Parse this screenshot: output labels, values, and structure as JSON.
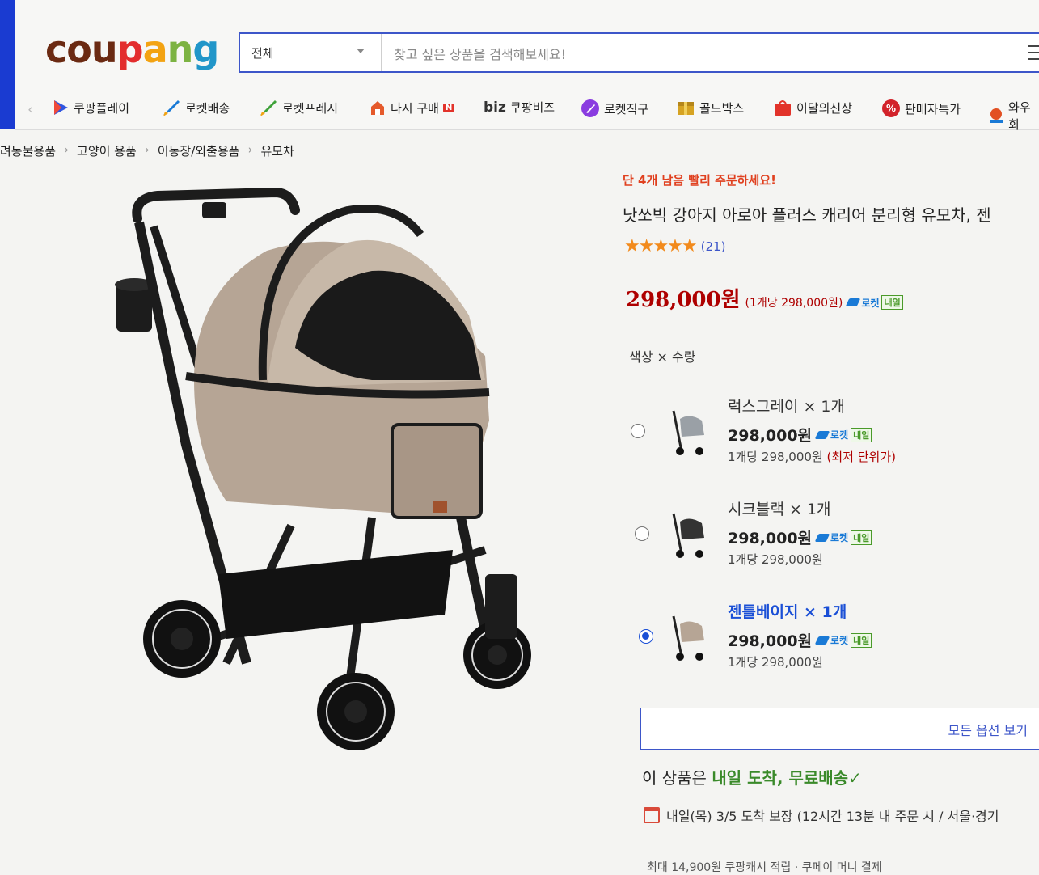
{
  "logo": {
    "parts": [
      "cou",
      "p",
      "a",
      "n",
      "g"
    ]
  },
  "search": {
    "category": "전체",
    "placeholder": "찾고 싶은 상품을 검색해보세요!"
  },
  "nav": {
    "prev_glyph": "‹",
    "items": [
      {
        "label": "쿠팡플레이",
        "icon": "play-icon",
        "color": "#2f55e0"
      },
      {
        "label": "로켓배송",
        "icon": "rocket-icon",
        "color": "#1a7ad6"
      },
      {
        "label": "로켓프레시",
        "icon": "rocket-fresh-icon",
        "color": "#3fa23a"
      },
      {
        "label": "다시 구매",
        "icon": "repurchase-icon",
        "color": "#e55a2b",
        "badge": "N"
      },
      {
        "label": "쿠팡비즈",
        "prefix": "biz",
        "icon": "biz-icon",
        "color": "#222222"
      },
      {
        "label": "로켓직구",
        "icon": "rocket-global-icon",
        "color": "#8a3ce0"
      },
      {
        "label": "골드박스",
        "icon": "goldbox-icon",
        "color": "#c8911c"
      },
      {
        "label": "이달의신상",
        "icon": "new-icon",
        "color": "#e2332a"
      },
      {
        "label": "판매자특가",
        "icon": "seller-deal-icon",
        "color": "#d2232a"
      },
      {
        "label": "와우회",
        "icon": "wow-icon",
        "color": "#e25022"
      }
    ]
  },
  "breadcrumb": {
    "items": [
      "려동물용품",
      "고양이 용품",
      "이동장/외출용품",
      "유모차"
    ],
    "sep": "›"
  },
  "product": {
    "urgency": "단 4개 남음 빨리 주문하세요!",
    "title": "낫쏘빅 강아지 아로아 플러스 캐리어 분리형 유모차, 젠",
    "stars": "★★★★★",
    "review_count": "(21)",
    "price": "298,000원",
    "unit_price": "(1개당 298,000원)"
  },
  "badges": {
    "rocket": "로켓",
    "tomorrow": "내일"
  },
  "options": {
    "label": "색상 × 수량",
    "items": [
      {
        "name": "럭스그레이 × 1개",
        "price": "298,000원",
        "unit": "1개당 298,000원",
        "lowest": "(최저 단위가)",
        "selected": false
      },
      {
        "name": "시크블랙 × 1개",
        "price": "298,000원",
        "unit": "1개당 298,000원",
        "lowest": "",
        "selected": false
      },
      {
        "name": "젠틀베이지 × 1개",
        "price": "298,000원",
        "unit": "1개당 298,000원",
        "lowest": "",
        "selected": true
      }
    ],
    "all_button": "모든 옵션 보기"
  },
  "delivery": {
    "title_prefix": "이 상품은 ",
    "title_green": "내일 도착, 무료배송",
    "check": "✓",
    "date": "내일(목) 3/5 도착 보장 (12시간 13분 내 주문 시 / 서울⋅경기",
    "bottom": "최대 14,900원 쿠팡캐시 적립 · 쿠페이 머니 결제"
  },
  "colors": {
    "brand_blue": "#3d56c9",
    "price_red": "#ae0000",
    "urgency_orange": "#e0401f",
    "delivery_green": "#3a8a2a",
    "star_orange": "#f28a1c"
  }
}
